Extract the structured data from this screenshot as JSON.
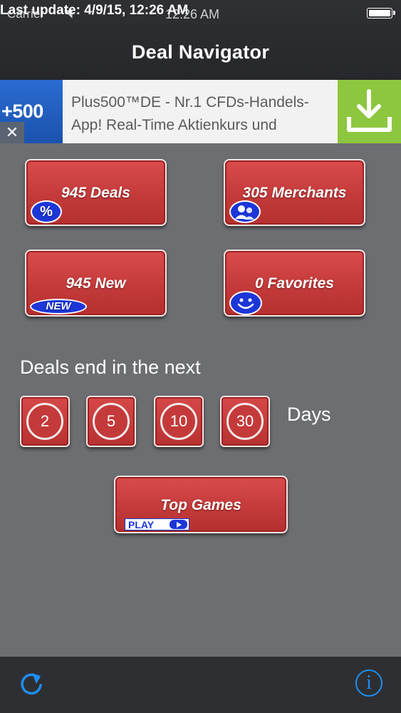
{
  "status_bar": {
    "carrier": "Carrier",
    "time": "12:26 AM",
    "last_update": "Last update: 4/9/15, 12:26 AM"
  },
  "nav": {
    "title": "Deal Navigator"
  },
  "ad": {
    "brand": "+500",
    "text": "Plus500™DE - Nr.1 CFDs-Handels-App! Real-Time Aktienkurs und",
    "close_symbol": "✕",
    "download_icon": "download-icon",
    "accent_color": "#8dc63f"
  },
  "grid": {
    "deals_label": "945 Deals",
    "merchants_label": "305 Merchants",
    "new_label": "945 New",
    "new_badge": "NEW",
    "favorites_label": "0 Favorites"
  },
  "deals_end": {
    "label": "Deals end in the next",
    "options": [
      "2",
      "5",
      "10",
      "30"
    ],
    "unit": "Days"
  },
  "top_games": {
    "label": "Top Games",
    "badge": "PLAY"
  },
  "toolbar": {
    "refresh_icon": "refresh-icon",
    "info_symbol": "i"
  },
  "colors": {
    "button_red": "#c43a3a",
    "badge_blue": "#1c36d8",
    "toolbar_blue": "#1e8ff0"
  }
}
